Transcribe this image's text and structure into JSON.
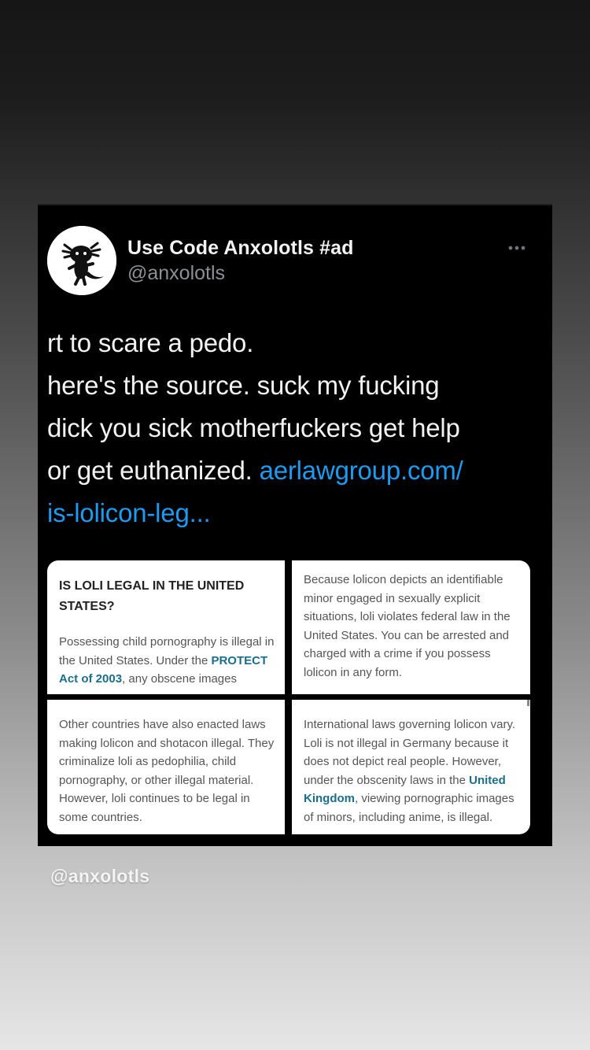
{
  "tweet": {
    "display_name": "Use Code Anxolotls #ad",
    "handle": "@anxolotls",
    "more_icon": "more-horizontal-icon",
    "text_lines": [
      "rt to scare a pedo.",
      "here's the source. suck my fucking",
      "dick you sick motherfuckers get help",
      "or get euthanized. "
    ],
    "link_part1": "aerlawgroup.com/",
    "link_part2": "is-lolicon-leg...",
    "link_color": "#1d9bf0"
  },
  "media": {
    "panel1": {
      "heading": "IS LOLI LEGAL IN THE UNITED STATES?",
      "body_before": "Possessing child pornography is illegal in the United States. Under the ",
      "body_link": "PROTECT Act of 2003",
      "body_after": ", any obscene images"
    },
    "panel2": {
      "body": "Because lolicon depicts an identifiable minor engaged in sexually explicit situations, loli violates federal law in the United States. You can be arrested and charged with a crime if you possess lolicon in any form."
    },
    "panel3": {
      "body": "Other countries have also enacted laws making lolicon and shotacon illegal. They criminalize loli as pedophilia, child pornography, or other illegal material. However, loli continues to be legal in some countries."
    },
    "panel4": {
      "body_before": "International laws governing lolicon vary. Loli is not illegal in Germany because it does not depict real people. However, under the obscenity laws in the ",
      "body_link": "United Kingdom",
      "body_after": ", viewing pornographic images of minors, including anime, is illegal."
    },
    "accent_color": "#1a6e8a"
  },
  "story": {
    "mention": "@anxolotls"
  }
}
